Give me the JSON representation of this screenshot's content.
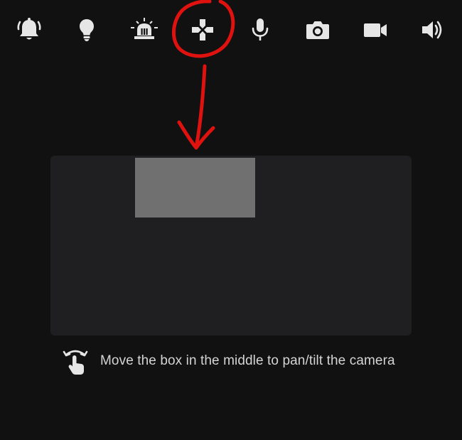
{
  "toolbar": {
    "items": [
      {
        "name": "alarm",
        "icon": "alarm-bell-icon"
      },
      {
        "name": "light",
        "icon": "light-bulb-icon"
      },
      {
        "name": "siren",
        "icon": "siren-icon"
      },
      {
        "name": "pan-tilt",
        "icon": "gamepad-dpad-icon",
        "highlighted": true
      },
      {
        "name": "microphone",
        "icon": "microphone-icon"
      },
      {
        "name": "snapshot",
        "icon": "camera-icon"
      },
      {
        "name": "record",
        "icon": "video-camera-icon"
      },
      {
        "name": "speaker",
        "icon": "speaker-icon"
      }
    ]
  },
  "annotation": {
    "color": "#e0120f",
    "shape": "circle-with-down-arrow"
  },
  "pan_tilt_pad": {
    "background": "#1f1f21",
    "box_color": "#707070"
  },
  "hint": {
    "icon": "hand-swipe-icon",
    "text": "Move the box in the middle to pan/tilt the camera"
  },
  "colors": {
    "background": "#111112",
    "icon": "#e6e6e6",
    "text": "#d4d4d4"
  }
}
